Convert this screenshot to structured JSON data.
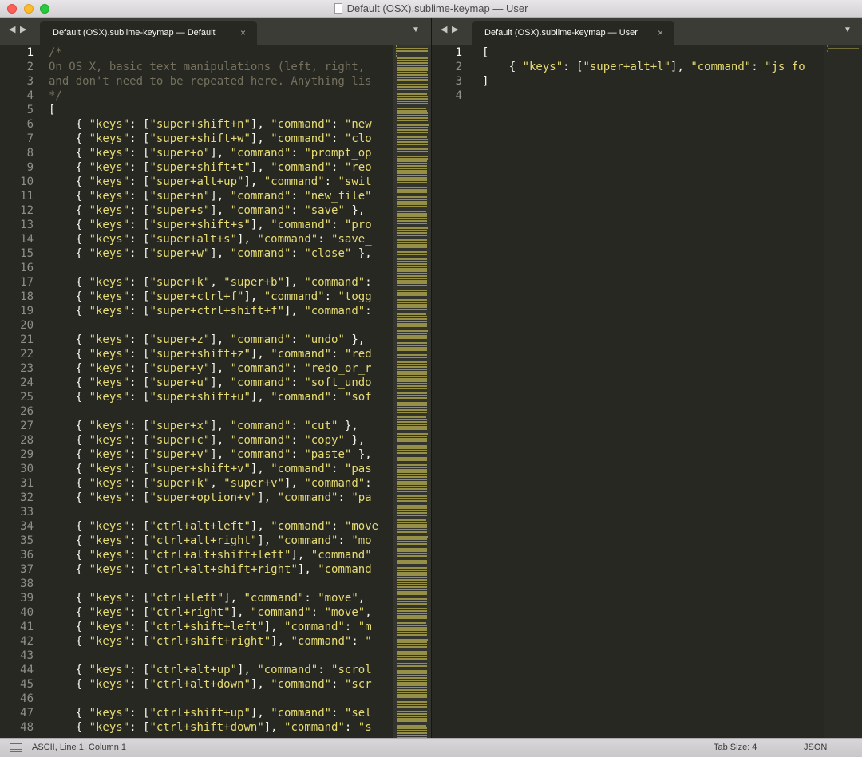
{
  "window": {
    "title": "Default (OSX).sublime-keymap — User"
  },
  "left_pane": {
    "tab_label": "Default (OSX).sublime-keymap — Default",
    "tab_close": "×",
    "current_line": 1,
    "lines": [
      "/*",
      "On OS X, basic text manipulations (left, right,",
      "and don't need to be repeated here. Anything lis",
      "*/",
      "[",
      "    { \"keys\": [\"super+shift+n\"], \"command\": \"new",
      "    { \"keys\": [\"super+shift+w\"], \"command\": \"clo",
      "    { \"keys\": [\"super+o\"], \"command\": \"prompt_op",
      "    { \"keys\": [\"super+shift+t\"], \"command\": \"reo",
      "    { \"keys\": [\"super+alt+up\"], \"command\": \"swit",
      "    { \"keys\": [\"super+n\"], \"command\": \"new_file\"",
      "    { \"keys\": [\"super+s\"], \"command\": \"save\" },",
      "    { \"keys\": [\"super+shift+s\"], \"command\": \"pro",
      "    { \"keys\": [\"super+alt+s\"], \"command\": \"save_",
      "    { \"keys\": [\"super+w\"], \"command\": \"close\" },",
      "",
      "    { \"keys\": [\"super+k\", \"super+b\"], \"command\":",
      "    { \"keys\": [\"super+ctrl+f\"], \"command\": \"togg",
      "    { \"keys\": [\"super+ctrl+shift+f\"], \"command\":",
      "",
      "    { \"keys\": [\"super+z\"], \"command\": \"undo\" },",
      "    { \"keys\": [\"super+shift+z\"], \"command\": \"red",
      "    { \"keys\": [\"super+y\"], \"command\": \"redo_or_r",
      "    { \"keys\": [\"super+u\"], \"command\": \"soft_undo",
      "    { \"keys\": [\"super+shift+u\"], \"command\": \"sof",
      "",
      "    { \"keys\": [\"super+x\"], \"command\": \"cut\" },",
      "    { \"keys\": [\"super+c\"], \"command\": \"copy\" },",
      "    { \"keys\": [\"super+v\"], \"command\": \"paste\" },",
      "    { \"keys\": [\"super+shift+v\"], \"command\": \"pas",
      "    { \"keys\": [\"super+k\", \"super+v\"], \"command\":",
      "    { \"keys\": [\"super+option+v\"], \"command\": \"pa",
      "",
      "    { \"keys\": [\"ctrl+alt+left\"], \"command\": \"move",
      "    { \"keys\": [\"ctrl+alt+right\"], \"command\": \"mo",
      "    { \"keys\": [\"ctrl+alt+shift+left\"], \"command\"",
      "    { \"keys\": [\"ctrl+alt+shift+right\"], \"command",
      "",
      "    { \"keys\": [\"ctrl+left\"], \"command\": \"move\",",
      "    { \"keys\": [\"ctrl+right\"], \"command\": \"move\",",
      "    { \"keys\": [\"ctrl+shift+left\"], \"command\": \"m",
      "    { \"keys\": [\"ctrl+shift+right\"], \"command\": \"",
      "",
      "    { \"keys\": [\"ctrl+alt+up\"], \"command\": \"scrol",
      "    { \"keys\": [\"ctrl+alt+down\"], \"command\": \"scr",
      "",
      "    { \"keys\": [\"ctrl+shift+up\"], \"command\": \"sel",
      "    { \"keys\": [\"ctrl+shift+down\"], \"command\": \"s"
    ]
  },
  "right_pane": {
    "tab_label": "Default (OSX).sublime-keymap — User",
    "tab_close": "×",
    "current_line": 1,
    "lines": [
      "[",
      "    { \"keys\": [\"super+alt+l\"], \"command\": \"js_fo",
      "]",
      ""
    ]
  },
  "status_bar": {
    "position": "ASCII, Line 1, Column 1",
    "tab_size": "Tab Size: 4",
    "syntax": "JSON"
  },
  "icons": {
    "nav_back": "◀",
    "nav_forward": "▶",
    "tab_dropdown": "▼"
  },
  "colors": {
    "editor_bg": "#272822",
    "string": "#e6db74",
    "comment": "#75715e",
    "text": "#f8f8f2",
    "gutter": "#90908a"
  }
}
